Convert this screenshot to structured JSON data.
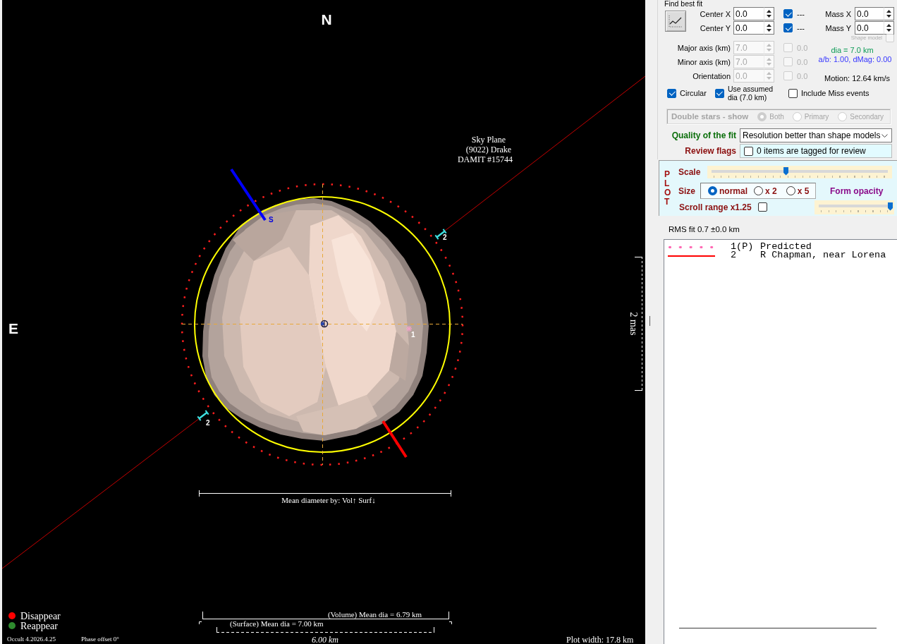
{
  "sky_plot": {
    "north": "N",
    "east": "E",
    "title": "Sky Plane",
    "object": "(9022) Drake",
    "model": "DAMIT #15744",
    "pole_label": "S",
    "star_label": "1",
    "chord_markers": [
      {
        "label": "2"
      },
      {
        "label": "2"
      }
    ],
    "scale_label": "2 mas",
    "diameter_caption": "Mean diameter by: Vol↑ Surf↓",
    "volume_diameter": "(Volume) Mean dia = 6.79 km",
    "surface_diameter": "(Surface) Mean dia = 7.00 km",
    "km_scale": "6.00 km",
    "legend": [
      {
        "label": "Disappear",
        "color": "#ff0000"
      },
      {
        "label": "Reappear",
        "color": "#2e8b2e"
      }
    ],
    "version": "Occult 4.2026.4.25",
    "phase_offset": "Phase offset 0°",
    "plot_width": "Plot width: 17.8 km"
  },
  "fit": {
    "title": "Find best fit",
    "offsets": [
      {
        "label": "Center X",
        "value": "0.0",
        "checked": true,
        "note": "---"
      },
      {
        "label": "Center Y",
        "value": "0.0",
        "checked": true,
        "note": "---"
      }
    ],
    "mass": [
      {
        "label": "Mass X",
        "value": "0.0"
      },
      {
        "label": "Mass Y",
        "value": "0.0"
      }
    ],
    "shape_model": {
      "label": "Shape model",
      "checked": false,
      "disabled": true
    },
    "axes": [
      {
        "label": "Major axis (km)",
        "value": "7.0",
        "checked": false,
        "reading": "0.0",
        "disabled": true
      },
      {
        "label": "Minor axis (km)",
        "value": "7.0",
        "checked": false,
        "reading": "0.0",
        "disabled": true
      },
      {
        "label": "Orientation",
        "value": "0.0",
        "checked": false,
        "reading": "0.0",
        "disabled": true
      }
    ],
    "dia_note": "dia = 7.0 km",
    "ratio_note": "a/b: 1.00, dMag: 0.00",
    "motion": "Motion: 12.64 km/s",
    "options": [
      {
        "label": "Circular",
        "checked": true
      },
      {
        "label": "Use assumed dia (7.0 km)",
        "checked": true
      },
      {
        "label": "Include Miss events",
        "checked": false
      }
    ]
  },
  "double_stars": {
    "label": "Double stars - show",
    "disabled": true,
    "options": [
      {
        "label": "Both",
        "selected": true
      },
      {
        "label": "Primary",
        "selected": false
      },
      {
        "label": "Secondary",
        "selected": false
      }
    ]
  },
  "quality": {
    "label": "Quality of the fit",
    "value": "Resolution better than shape models"
  },
  "review": {
    "label": "Review flags",
    "checked": false,
    "text": "0 items are tagged for review"
  },
  "plot_settings": {
    "title": "PLOT",
    "scale": {
      "label": "Scale",
      "level": 0.42
    },
    "size": {
      "label": "Size",
      "options": [
        {
          "label": "normal",
          "selected": true
        },
        {
          "label": "x 2",
          "selected": false
        },
        {
          "label": "x 5",
          "selected": false
        }
      ]
    },
    "opacity": {
      "label": "Form opacity",
      "level": 1
    },
    "scroll_range": {
      "label": "Scroll range x1.25",
      "checked": false
    }
  },
  "rms": "RMS fit 0.7 ±0.0 km",
  "observers": [
    {
      "number": "1(P)",
      "name": "Predicted",
      "kind": "dotted",
      "color": "#ff66b2"
    },
    {
      "number": "2",
      "name": "R Chapman, near Lorena",
      "kind": "solid",
      "color": "#ff0000"
    }
  ]
}
